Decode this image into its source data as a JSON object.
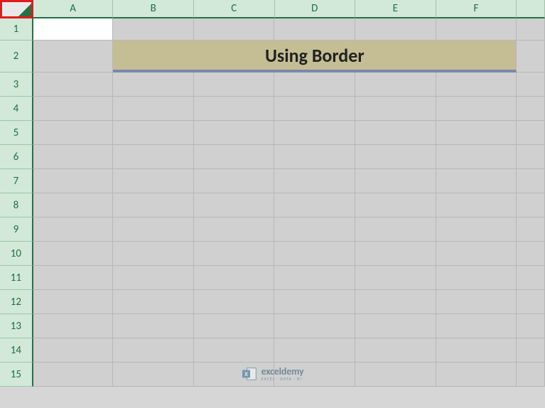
{
  "columns": [
    "A",
    "B",
    "C",
    "D",
    "E",
    "F",
    ""
  ],
  "rows": [
    "1",
    "2",
    "3",
    "4",
    "5",
    "6",
    "7",
    "8",
    "9",
    "10",
    "11",
    "12",
    "13",
    "14",
    "15"
  ],
  "title_cell": {
    "text": "Using Border",
    "range": "B2:F2"
  },
  "watermark": {
    "main": "exceldemy",
    "sub": "EXCEL · DATA · BI"
  },
  "chart_data": null
}
